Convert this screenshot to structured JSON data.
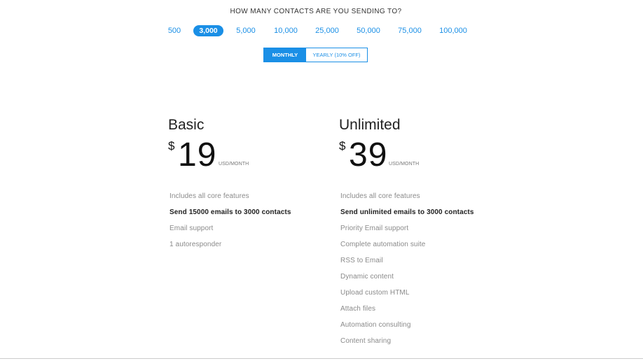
{
  "header": {
    "question": "HOW MANY CONTACTS ARE YOU SENDING TO?"
  },
  "contacts": {
    "options": [
      "500",
      "3,000",
      "5,000",
      "10,000",
      "25,000",
      "50,000",
      "75,000",
      "100,000"
    ],
    "selected": "3,000"
  },
  "billing": {
    "monthly_label": "MONTHLY",
    "yearly_label": "YEARLY (10% OFF)",
    "selected": "MONTHLY"
  },
  "colors": {
    "accent": "#1a8fe6",
    "text_dark": "#222222",
    "text_muted": "#8a8a8a"
  },
  "plans": [
    {
      "name": "Basic",
      "currency": "$",
      "price": "19",
      "period": "USD/MONTH",
      "features": [
        {
          "text": "Includes all core features",
          "strong": false
        },
        {
          "text": "Send 15000 emails to 3000 contacts",
          "strong": true
        },
        {
          "text": "Email support",
          "strong": false
        },
        {
          "text": "1 autoresponder",
          "strong": false
        }
      ]
    },
    {
      "name": "Unlimited",
      "currency": "$",
      "price": "39",
      "period": "USD/MONTH",
      "features": [
        {
          "text": "Includes all core features",
          "strong": false
        },
        {
          "text": "Send unlimited emails to 3000 contacts",
          "strong": true
        },
        {
          "text": "Priority Email support",
          "strong": false
        },
        {
          "text": "Complete automation suite",
          "strong": false
        },
        {
          "text": "RSS to Email",
          "strong": false
        },
        {
          "text": "Dynamic content",
          "strong": false
        },
        {
          "text": "Upload custom HTML",
          "strong": false
        },
        {
          "text": "Attach files",
          "strong": false
        },
        {
          "text": "Automation consulting",
          "strong": false
        },
        {
          "text": "Content sharing",
          "strong": false
        }
      ]
    }
  ]
}
